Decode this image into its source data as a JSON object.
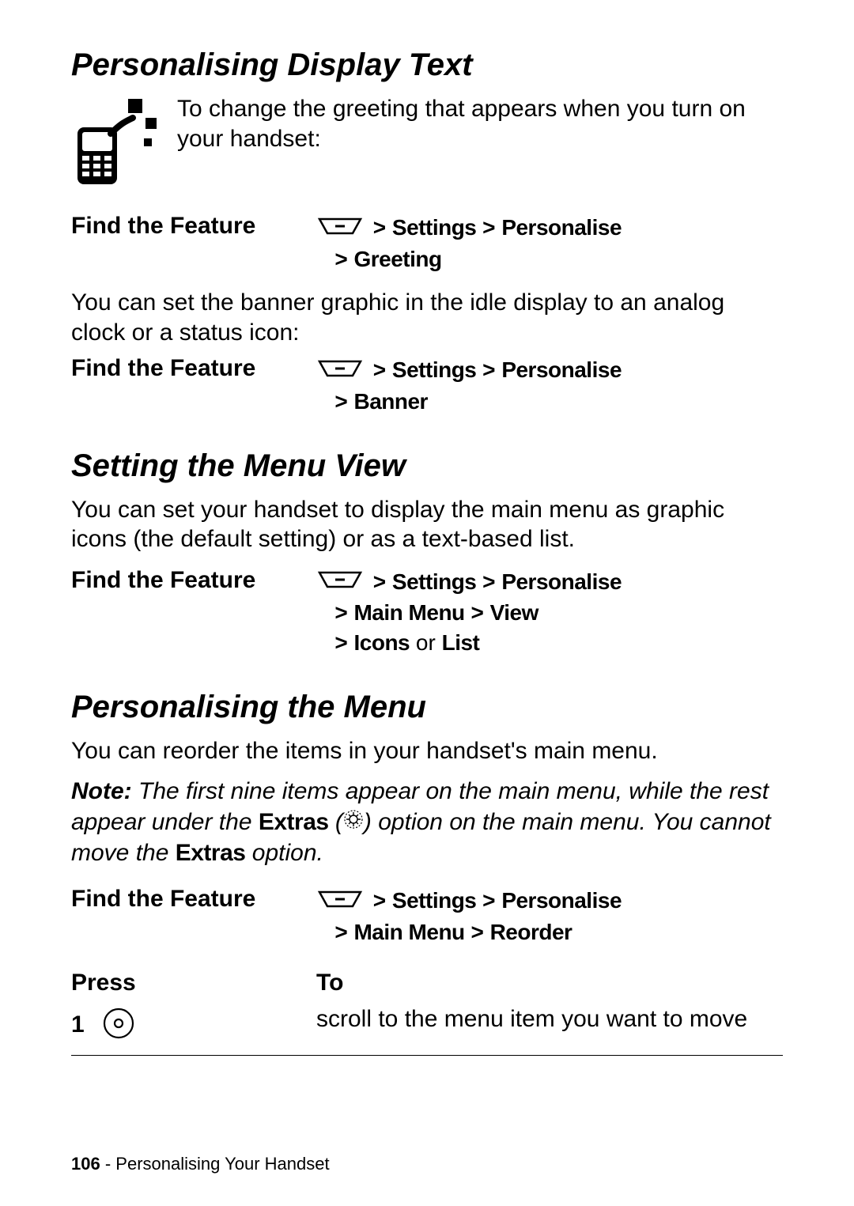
{
  "s1": {
    "heading": "Personalising Display Text",
    "intro": "To change the greeting that appears when you turn on your handset:",
    "find": "Find the Feature",
    "path1": "Settings",
    "path2": "Personalise",
    "path3": "Greeting",
    "body2": "You can set the banner graphic in the idle display to an analog clock or a status icon:",
    "path_b1": "Settings",
    "path_b2": "Personalise",
    "path_b3": "Banner"
  },
  "s2": {
    "heading": "Setting the Menu View",
    "body": "You can set your handset to display the main menu as graphic icons (the default setting) or as a text-based list.",
    "find": "Find the Feature",
    "p1": "Settings",
    "p2": "Personalise",
    "p3": "Main Menu",
    "p4": "View",
    "p5": "Icons",
    "or": " or ",
    "p6": "List"
  },
  "s3": {
    "heading": "Personalising the Menu",
    "body": "You can reorder the items in your handset's main menu.",
    "note_label": "Note:",
    "note_a": " The first nine items appear on the main menu, while the rest appear under the ",
    "extras": "Extras",
    "note_b": " (",
    "note_c": ") option on the main menu. You cannot move the ",
    "note_d": " option.",
    "find": "Find the Feature",
    "p1": "Settings",
    "p2": "Personalise",
    "p3": "Main Menu",
    "p4": "Reorder",
    "press_h": "Press",
    "to_h": "To",
    "step1": "1",
    "step1_to": "scroll to the menu item you want to move"
  },
  "footer": {
    "page": "106",
    "sep": " - ",
    "title": "Personalising Your Handset"
  }
}
